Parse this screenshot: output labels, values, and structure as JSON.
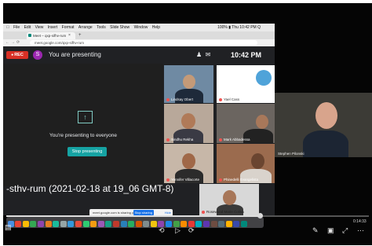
{
  "menubar": {
    "items": [
      "File",
      "Edit",
      "View",
      "Insert",
      "Format",
      "Arrange",
      "Tools",
      "Slide Show",
      "Window",
      "Help"
    ],
    "status": "100% ▮  Thu 10:42 PM  Q"
  },
  "browser": {
    "tab_title": "Meet – qxp-sifhv-rum",
    "address": "meet.google.com/qxp-sifhv-rum"
  },
  "meet": {
    "rec_label": "REC",
    "avatar_letter": "S",
    "presenting_label": "You are presenting",
    "time": "10:42 PM",
    "present_text": "You're presenting to everyone",
    "stop_label": "Stop presenting"
  },
  "participants": [
    {
      "name": "Lindsay Obert"
    },
    {
      "name": "Yael Cass"
    },
    {
      "name": "Sindhu Rekha"
    },
    {
      "name": "Mark Abbadessa"
    },
    {
      "name": "Yennifer Villacorte"
    },
    {
      "name": "Phinedelli Evangelista"
    },
    {
      "name": "Rosewood Marie Colina"
    }
  ],
  "big_video": {
    "name": "Stephen Pilonski"
  },
  "caption": "-sthv-rum (2021-02-18 at 19_06 GMT-8)",
  "share_popup": {
    "text": "meet.google.com is sharing your screen.",
    "stop": "Stop sharing",
    "hide": "Hide"
  },
  "player": {
    "time": "0:14:33",
    "progress": 0.7
  },
  "dock_colors": [
    "#4a90e2",
    "#e94335",
    "#fbbc05",
    "#34a853",
    "#8e44ad",
    "#e67e22",
    "#1abc9c",
    "#95a5a6",
    "#3498db",
    "#e74c3c",
    "#2ecc71",
    "#f39c12",
    "#9b59b6",
    "#16a085",
    "#c0392b",
    "#2980b9",
    "#27ae60",
    "#d35400",
    "#7f8c8d",
    "#f1c40f",
    "#8e44ad",
    "#1e88e5",
    "#43a047",
    "#fb8c00",
    "#e53935",
    "#00acc1",
    "#5e35b1",
    "#6d4c41",
    "#546e7a",
    "#ffb300",
    "#3949ab",
    "#00897b"
  ]
}
